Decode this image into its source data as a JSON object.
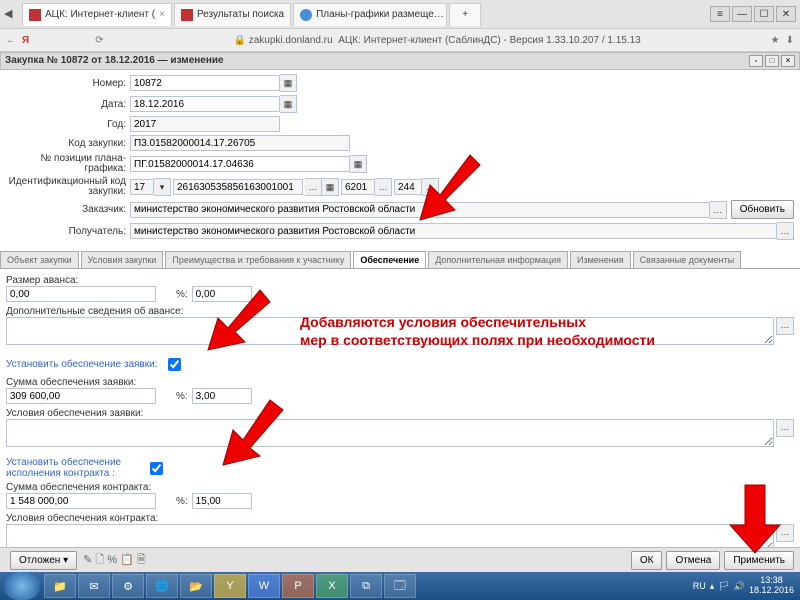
{
  "browser": {
    "tabs": [
      {
        "label": "АЦК: Интернет-клиент (",
        "close": "×"
      },
      {
        "label": "Результаты поиска"
      },
      {
        "label": "Планы-графики размеще…"
      }
    ],
    "url_host": "zakupki.donland.ru",
    "url_title": "АЦК: Интернет-клиент (СаблинДС) - Версия 1.33.10.207 / 1.15.13"
  },
  "panel": {
    "title": "Закупка № 10872 от 18.12.2016 — изменение"
  },
  "form": {
    "nomer_lbl": "Номер:",
    "nomer": "10872",
    "data_lbl": "Дата:",
    "data": "18.12.2016",
    "god_lbl": "Год:",
    "god": "2017",
    "kod_lbl": "Код закупки:",
    "kod": "П3.01582000014.17.26705",
    "poz_lbl": "№ позиции плана-графика:",
    "poz": "ПГ.01582000014.17.04636",
    "ident_lbl": "Идентификационный код закупки:",
    "ident_a": "17",
    "ident_b": "261630535856163001001",
    "ident_c": "6201",
    "ident_d": "244",
    "zak_lbl": "Заказчик:",
    "zak": "министерство экономического развития Ростовской области",
    "pol_lbl": "Получатель:",
    "pol": "министерство экономического развития Ростовской области",
    "obnovit": "Обновить"
  },
  "tabs": {
    "t1": "Объект закупки",
    "t2": "Условия закупки",
    "t3": "Преимущества и требования к участнику",
    "t4": "Обеспечение",
    "t5": "Дополнительная информация",
    "t6": "Изменения",
    "t7": "Связанные документы"
  },
  "sec": {
    "avans_lbl": "Размер аванса:",
    "avans": "0,00",
    "pct": "%:",
    "avans_pct": "0,00",
    "dop_lbl": "Дополнительные сведения об авансе:",
    "ust_z_lbl": "Установить обеспечение заявки:",
    "sum_z_lbl": "Сумма обеспечения заявки:",
    "sum_z": "309 600,00",
    "sum_z_pct": "3,00",
    "usl_z_lbl": "Условия обеспечения заявки:",
    "ust_k_lbl": "Установить обеспечение исполнения контракта :",
    "sum_k_lbl": "Сумма обеспечения контракта:",
    "sum_k": "1 548 000,00",
    "sum_k_pct": "15,00",
    "usl_k_lbl": "Условия обеспечения контракта:"
  },
  "dlg": {
    "otlozhen": "Отложен",
    "ok": "ОК",
    "cancel": "Отмена",
    "apply": "Применить"
  },
  "tray": {
    "lang": "RU",
    "time": "13:38",
    "date": "18.12.2016"
  },
  "annotation": "Добавляются условия обеспечительных\nмер в соответствующих полях при необходимости"
}
